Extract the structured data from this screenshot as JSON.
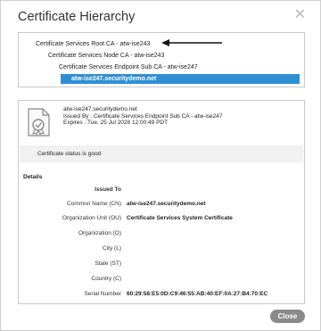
{
  "dialog": {
    "title": "Certificate Hierarchy",
    "close_icon": "close-icon",
    "close_button_label": "Close"
  },
  "hierarchy": {
    "nodes": [
      "Certificate Services Root CA - atw-ise243",
      "Certificate Services Node CA - atw-ise243",
      "Certificate Services Endpoint Sub CA - atw-ise247",
      "atw-ise247.securitydemo.net"
    ],
    "selected_index": 3,
    "annotation_icon": "arrow-left-icon"
  },
  "certificate": {
    "icon": "certificate-icon",
    "subject": "atw-ise247.securitydemo.net",
    "issued_by": "Issued By : Certificate Services Endpoint Sub CA - atw-ise247",
    "expires": "Expires : Tue, 25 Jul 2028 12:00:49 PDT",
    "status": "Certificate status is good"
  },
  "details": {
    "section_label": "Details",
    "issued_to_label": "Issued To",
    "fields": [
      {
        "label": "Common Name (CN)",
        "value": "atw-ise247.securitydemo.net"
      },
      {
        "label": "Organization Unit (OU)",
        "value": "Certificate Services System Certificate"
      },
      {
        "label": "Organization (O)",
        "value": ""
      },
      {
        "label": "City (L)",
        "value": ""
      },
      {
        "label": "State (ST)",
        "value": ""
      },
      {
        "label": "Country (C)",
        "value": ""
      },
      {
        "label": "Serial Number",
        "value": "60:29:58:E5:0D:C9:46:55:AB:40:EF:0A:27:B4:70:EC"
      }
    ]
  },
  "colors": {
    "selection": "#2f8fd5",
    "close_button": "#8a8a8a",
    "status_bar": "#f1f1f1"
  }
}
